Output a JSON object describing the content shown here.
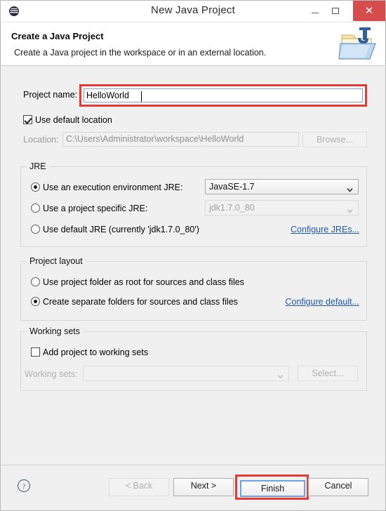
{
  "window": {
    "title": "New Java Project",
    "app_icon": "eclipse-icon",
    "controls": {
      "minimize": "minimize-icon",
      "maximize": "maximize-icon",
      "close": "close-icon",
      "close_glyph": "✕"
    }
  },
  "header": {
    "title": "Create a Java Project",
    "description": "Create a Java project in the workspace or in an external location.",
    "icon": "java-project-folder-icon"
  },
  "project_name": {
    "label": "Project name:",
    "value": "HelloWorld",
    "placeholder": "",
    "highlight_color": "#e63a35"
  },
  "location": {
    "use_default_label": "Use default location",
    "use_default_checked": true,
    "label": "Location:",
    "value": "C:\\Users\\Administrator\\workspace\\HelloWorld",
    "browse_label": "Browse..."
  },
  "jre": {
    "group_title": "JRE",
    "option_execution_env": {
      "label": "Use an execution environment JRE:",
      "selected": true,
      "value": "JavaSE-1.7"
    },
    "option_project_specific": {
      "label": "Use a project specific JRE:",
      "selected": false,
      "value": "jdk1.7.0_80"
    },
    "option_default": {
      "label": "Use default JRE (currently 'jdk1.7.0_80')",
      "selected": false
    },
    "configure_link": "Configure JREs..."
  },
  "project_layout": {
    "group_title": "Project layout",
    "option_project_folder": {
      "label": "Use project folder as root for sources and class files",
      "selected": false
    },
    "option_separate_folders": {
      "label": "Create separate folders for sources and class files",
      "selected": true
    },
    "configure_link": "Configure default..."
  },
  "working_sets": {
    "group_title": "Working sets",
    "add_label": "Add project to working sets",
    "add_checked": false,
    "label": "Working sets:",
    "value": "",
    "select_label": "Select..."
  },
  "buttons": {
    "help": "help-icon",
    "back": "< Back",
    "back_disabled": true,
    "next": "Next >",
    "finish": "Finish",
    "finish_highlight_color": "#e63a35",
    "finish_focus_color": "#6ba3de",
    "cancel": "Cancel"
  }
}
